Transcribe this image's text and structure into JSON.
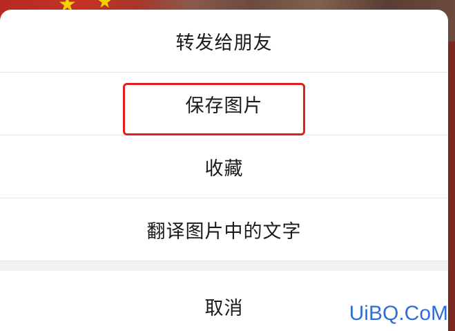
{
  "menu": {
    "items": [
      {
        "label": "转发给朋友"
      },
      {
        "label": "保存图片"
      },
      {
        "label": "收藏"
      },
      {
        "label": "翻译图片中的文字"
      }
    ],
    "cancel_label": "取消"
  },
  "watermark": "UiBQ.CoM",
  "colors": {
    "highlight": "#e0201c",
    "watermark": "#2d6fd6"
  }
}
